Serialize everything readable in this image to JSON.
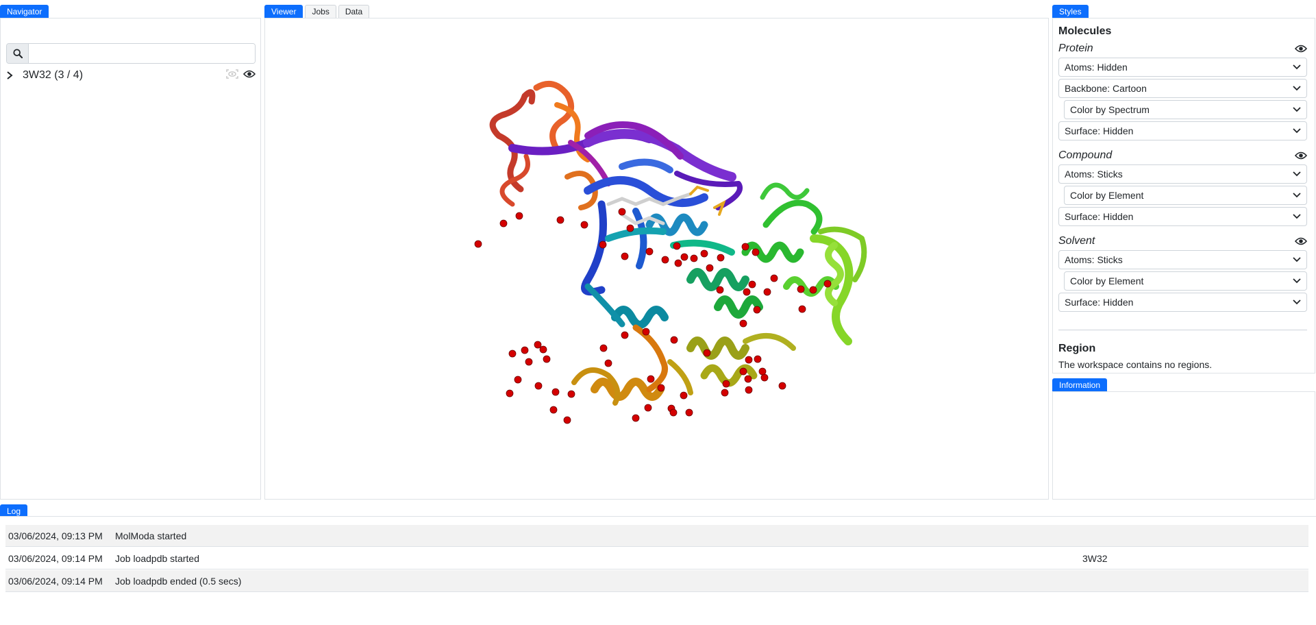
{
  "navigator": {
    "tab": "Navigator",
    "search": {
      "placeholder": "",
      "value": ""
    },
    "tree": [
      {
        "label": "3W32 (3 / 4)",
        "expanded": false
      }
    ]
  },
  "viewer": {
    "tabs": [
      "Viewer",
      "Jobs",
      "Data"
    ],
    "active_tab": "Viewer"
  },
  "styles": {
    "tab": "Styles",
    "molecules_title": "Molecules",
    "groups": [
      {
        "name": "Protein",
        "rows": [
          "Atoms: Hidden",
          "Backbone: Cartoon",
          "Color by Spectrum",
          "Surface: Hidden"
        ]
      },
      {
        "name": "Compound",
        "rows": [
          "Atoms: Sticks",
          "Color by Element",
          "Surface: Hidden"
        ]
      },
      {
        "name": "Solvent",
        "rows": [
          "Atoms: Sticks",
          "Color by Element",
          "Surface: Hidden"
        ]
      }
    ],
    "region_title": "Region",
    "region_text": "The workspace contains no regions."
  },
  "information": {
    "tab": "Information"
  },
  "log": {
    "tab": "Log",
    "rows": [
      {
        "time": "03/06/2024, 09:13 PM",
        "message": "MolModa started",
        "extra": ""
      },
      {
        "time": "03/06/2024, 09:14 PM",
        "message": "Job loadpdb started",
        "extra": "3W32"
      },
      {
        "time": "03/06/2024, 09:14 PM",
        "message": "Job loadpdb ended (0.5 secs)",
        "extra": ""
      }
    ]
  },
  "colors": {
    "accent": "#0d6efd",
    "border": "#dee2e6",
    "row_alt": "#f2f2f2",
    "water": "#d40000"
  },
  "icons": {
    "search": "search-icon",
    "chevron_right": "chevron-right-icon",
    "chevron_down": "chevron-down-icon",
    "eye": "eye-icon",
    "focus": "focus-icon"
  }
}
